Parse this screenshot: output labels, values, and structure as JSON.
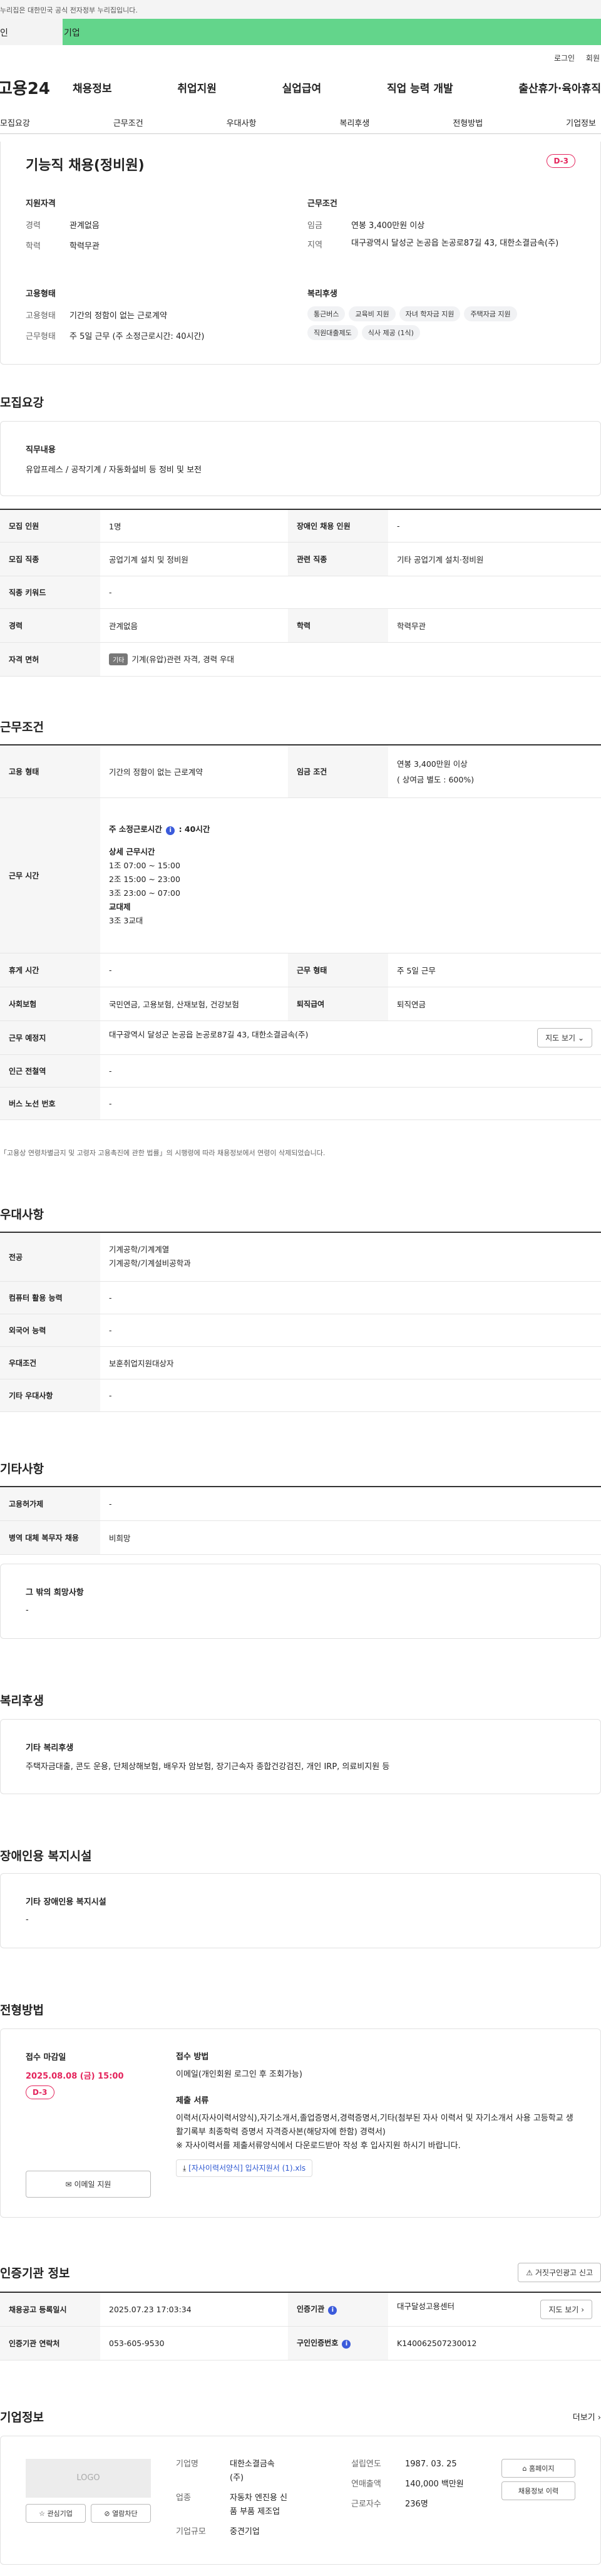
{
  "topbar": {
    "notice": "누리집은 대한민국 공식 전자정부 누리집입니다."
  },
  "tabs": [
    {
      "label": "인"
    },
    {
      "label": "기업"
    }
  ],
  "utils": {
    "login": "로그인",
    "join": "회원"
  },
  "gnb": {
    "logo": "고용24",
    "menu": [
      "채용정보",
      "취업지원",
      "실업급여",
      "직업 능력 개발",
      "출산휴가·육아휴직"
    ]
  },
  "subnav": [
    "모집요강",
    "근무조건",
    "우대사항",
    "복리후생",
    "전형방법",
    "기업정보"
  ],
  "summary": {
    "title": "기능직 채용(정비원)",
    "dday": "D-3",
    "qual_heading": "지원자격",
    "career_k": "경력",
    "career_v": "관계없음",
    "edu_k": "학력",
    "edu_v": "학력무관",
    "cond_heading": "근무조건",
    "wage_k": "임금",
    "wage_v": "연봉 3,400만원 이상",
    "area_k": "지역",
    "area_v": "대구광역시 달성군 논공읍 논공로87길 43, 대한소결금속(주)",
    "emp_heading": "고용형태",
    "emptype_k": "고용형태",
    "emptype_v": "기간의 정함이 없는 근로계약",
    "worktype_k": "근무형태",
    "worktype_v": "주 5일 근무 (주 소정근로시간: 40시간)",
    "welfare_heading": "복리후생",
    "chips": [
      "통근버스",
      "교육비 지원",
      "자녀 학자금 지원",
      "주택자금 지원",
      "직원대출제도",
      "식사 제공 (1식)"
    ]
  },
  "recruit": {
    "title": "모집요강",
    "duty_heading": "직무내용",
    "duty_text": "유압프레스 / 공작기계 / 자동화설비 등 정비 및 보전",
    "rows": [
      [
        "모집 인원",
        "1명",
        "장애인 채용 인원",
        "-"
      ],
      [
        "모집 직종",
        "공업기계 설치 및 정비원",
        "관련 직종",
        "기타 공업기계 설치·정비원"
      ],
      [
        "직종 키워드",
        "-"
      ],
      [
        "경력",
        "관계없음",
        "학력",
        "학력무관"
      ]
    ],
    "license_h": "자격 면허",
    "license_tag": "기타",
    "license_v": "기계(유압)관련 자격, 경력 우대"
  },
  "work": {
    "title": "근무조건",
    "emp_h": "고용 형태",
    "emp_v": "기간의 정함이 없는 근로계약",
    "wage_h": "임금 조건",
    "wage_v1": "연봉 3,400만원 이상",
    "wage_v2": "( 상여금 별도 : 600%)",
    "time_h": "근무 시간",
    "time_main_a": "주 소정근로시간",
    "time_main_b": ": 40시간",
    "time_detail_h": "상세 근무시간",
    "shifts": [
      "1조 07:00 ~ 15:00",
      "2조 15:00 ~ 23:00",
      "3조 23:00 ~ 07:00"
    ],
    "shift_h": "교대제",
    "shift_v": "3조 3교대",
    "rest_h": "휴게 시간",
    "rest_v": "-",
    "form_h": "근무 형태",
    "form_v": "주 5일 근무",
    "ins_h": "사회보험",
    "ins_v": "국민연금, 고용보험, 산재보험, 건강보험",
    "retire_h": "퇴직급여",
    "retire_v": "퇴직연금",
    "place_h": "근무 예정지",
    "place_v": "대구광역시 달성군 논공읍 논공로87길 43, 대한소결금속(주)",
    "map_btn": "지도 보기",
    "subway_h": "인근 전철역",
    "subway_v": "-",
    "bus_h": "버스 노선 번호",
    "bus_v": "-",
    "note": "「고용상 연령차별금지 및 고령자 고용촉진에 관한 법률」의 시행령에 따라 채용정보에서 연령이 삭제되었습니다."
  },
  "pref": {
    "title": "우대사항",
    "major_h": "전공",
    "major_v1": "기계공학/기계계열",
    "major_v2": "기계공학/기계설비공학과",
    "computer_h": "컴퓨터 활용 능력",
    "computer_v": "-",
    "lang_h": "외국어 능력",
    "lang_v": "-",
    "cond_h": "우대조건",
    "cond_v": "보훈취업지원대상자",
    "etc_h": "기타 우대사항",
    "etc_v": "-"
  },
  "other": {
    "title": "기타사항",
    "disabled_h": "고용허가제",
    "disabled_v": "-",
    "military_h": "병역 대체 복무자 채용",
    "military_v": "비희망",
    "etc_heading": "그 밖의 희망사항",
    "etc_v": "-"
  },
  "welfare": {
    "title": "복리후생",
    "heading": "기타 복리후생",
    "text": "주택자금대출, 콘도 운용, 단체상해보험, 배우자 암보험, 장기근속자 종합건강검진, 개인 IRP, 의료비지원 등"
  },
  "facility": {
    "title": "장애인용 복지시설",
    "heading": "기타 장애인용 복지시설",
    "text": "-"
  },
  "selection": {
    "title": "전형방법",
    "deadline_h": "접수 마감일",
    "deadline": "2025.08.08 (금) 15:00",
    "dday": "D-3",
    "email_btn": "이메일 지원",
    "method_h": "접수 방법",
    "method_v": "이메일(개인회원 로그인 후 조회가능)",
    "docs_h": "제출 서류",
    "docs_v": "이력서(자사이력서양식),자기소개서,졸업증명서,경력증명서,기타(첨부된 자사 이력서 및 자기소개서 사용 고등학교 생활기록부 최종학력 증명서 자격증사본(해당자에 한함) 경력서)",
    "docs_note": "※ 자사이력서를 제출서류양식에서 다운로드받아 작성 후 입사지원 하시기 바랍니다.",
    "file_link": "[자사이력서양식] 입사지원서 (1).xls"
  },
  "agency": {
    "title": "인증기관 정보",
    "report_btn": "거짓구인광고 신고",
    "reg_h": "채용공고 등록일시",
    "reg_v": "2025.07.23 17:03:34",
    "org_h": "인증기관",
    "org_v": "대구달성고용센터",
    "tel_h": "인증기관 연락처",
    "tel_v": "053-605-9530",
    "no_h": "구인인증번호",
    "no_v": "K140062507230012",
    "map_btn": "지도 보기"
  },
  "company": {
    "title": "기업정보",
    "more": "더보기",
    "logo": "LOGO",
    "fav_btn": "관심기업",
    "block_btn": "열람차단",
    "name_k": "기업명",
    "name_v1": "대한소결금속",
    "name_v2": "(주)",
    "industry_k": "업종",
    "industry_v1": "자동차 엔진용 신",
    "industry_v2": "품 부품 제조업",
    "size_k": "기업규모",
    "size_v": "중견기업",
    "founded_k": "설립연도",
    "founded_v": "1987. 03. 25",
    "sales_k": "연매출액",
    "sales_v": "140,000 백만원",
    "staff_k": "근로자수",
    "staff_v": "236명",
    "home_btn": "홈페이지",
    "jobs_btn": "채용정보 이력"
  }
}
